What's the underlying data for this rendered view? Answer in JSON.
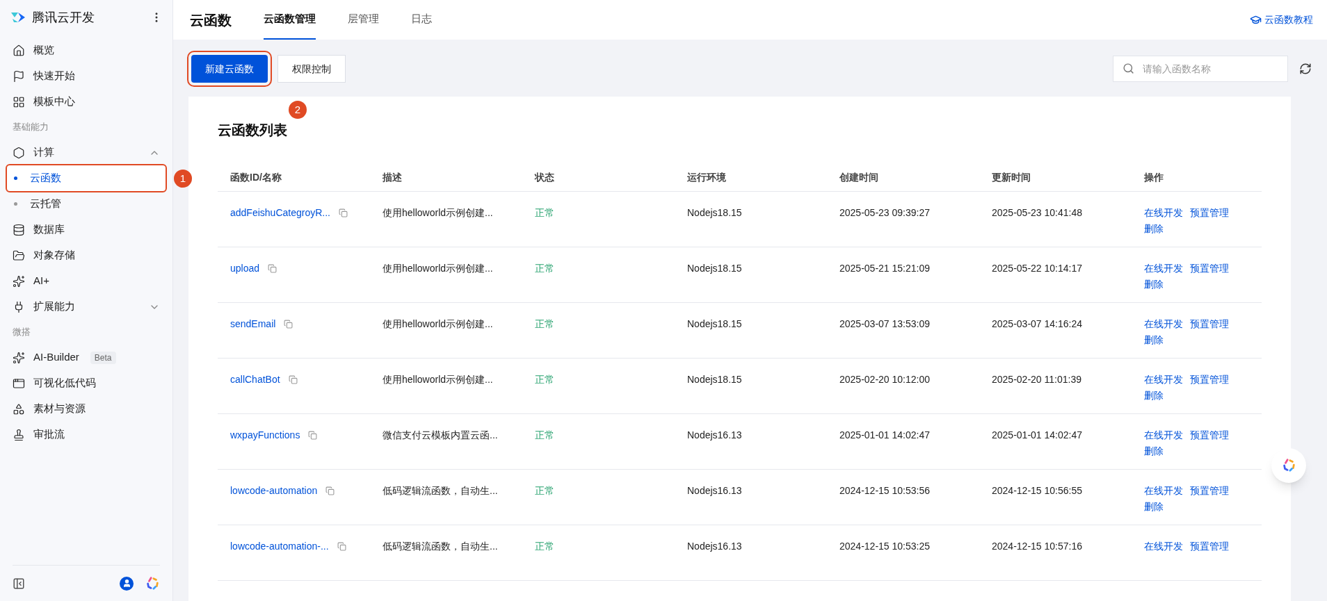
{
  "sidebar": {
    "brand": "腾讯云开发",
    "items": [
      {
        "kind": "item",
        "label": "概览",
        "selected": false
      },
      {
        "kind": "item",
        "label": "快速开始",
        "selected": false
      },
      {
        "kind": "item",
        "label": "模板中心",
        "selected": false
      },
      {
        "kind": "section",
        "label": "基础能力"
      },
      {
        "kind": "group",
        "label": "计算",
        "expanded": true,
        "children": [
          {
            "label": "云函数",
            "selected": true,
            "callout": "1"
          },
          {
            "label": "云托管",
            "selected": false
          }
        ]
      },
      {
        "kind": "item",
        "label": "数据库",
        "selected": false
      },
      {
        "kind": "item",
        "label": "对象存储",
        "selected": false
      },
      {
        "kind": "item",
        "label": "AI+",
        "selected": false
      },
      {
        "kind": "group",
        "label": "扩展能力",
        "expanded": false
      },
      {
        "kind": "section",
        "label": "微搭"
      },
      {
        "kind": "item",
        "label": "AI-Builder",
        "badge": "Beta",
        "selected": false
      },
      {
        "kind": "item",
        "label": "可视化低代码",
        "selected": false
      },
      {
        "kind": "item",
        "label": "素材与资源",
        "selected": false
      },
      {
        "kind": "item",
        "label": "审批流",
        "selected": false
      }
    ]
  },
  "header": {
    "title": "云函数",
    "tabs": [
      {
        "label": "云函数管理",
        "selected": true
      },
      {
        "label": "层管理",
        "selected": false
      },
      {
        "label": "日志",
        "selected": false
      }
    ],
    "help_link": "云函数教程"
  },
  "toolbar": {
    "buttons": [
      {
        "label": "新建云函数",
        "kind": "primary",
        "callout": "2"
      },
      {
        "label": "权限控制",
        "kind": "default"
      }
    ],
    "search": {
      "placeholder": "请输入函数名称"
    }
  },
  "table": {
    "title": "云函数列表",
    "columns": [
      "函数ID/名称",
      "描述",
      "状态",
      "运行环境",
      "创建时间",
      "更新时间",
      "操作"
    ],
    "rows": [
      {
        "name": "addFeishuCategroyR...",
        "description": "使用helloworld示例创建...",
        "status": "正常",
        "runtime": "Nodejs18.15",
        "created": "2025-05-23 09:39:27",
        "updated": "2025-05-23 10:41:48",
        "actions": [
          "在线开发",
          "预置管理",
          "删除"
        ]
      },
      {
        "name": "upload",
        "description": "使用helloworld示例创建...",
        "status": "正常",
        "runtime": "Nodejs18.15",
        "created": "2025-05-21 15:21:09",
        "updated": "2025-05-22 10:14:17",
        "actions": [
          "在线开发",
          "预置管理",
          "删除"
        ]
      },
      {
        "name": "sendEmail",
        "description": "使用helloworld示例创建...",
        "status": "正常",
        "runtime": "Nodejs18.15",
        "created": "2025-03-07 13:53:09",
        "updated": "2025-03-07 14:16:24",
        "actions": [
          "在线开发",
          "预置管理",
          "删除"
        ]
      },
      {
        "name": "callChatBot",
        "description": "使用helloworld示例创建...",
        "status": "正常",
        "runtime": "Nodejs18.15",
        "created": "2025-02-20 10:12:00",
        "updated": "2025-02-20 11:01:39",
        "actions": [
          "在线开发",
          "预置管理",
          "删除"
        ]
      },
      {
        "name": "wxpayFunctions",
        "description": "微信支付云模板内置云函...",
        "status": "正常",
        "runtime": "Nodejs16.13",
        "created": "2025-01-01 14:02:47",
        "updated": "2025-01-01 14:02:47",
        "actions": [
          "在线开发",
          "预置管理",
          "删除"
        ]
      },
      {
        "name": "lowcode-automation",
        "description": "低码逻辑流函数，自动生...",
        "status": "正常",
        "runtime": "Nodejs16.13",
        "created": "2024-12-15 10:53:56",
        "updated": "2024-12-15 10:56:55",
        "actions": [
          "在线开发",
          "预置管理",
          "删除"
        ]
      },
      {
        "name": "lowcode-automation-...",
        "description": "低码逻辑流函数，自动生...",
        "status": "正常",
        "runtime": "Nodejs16.13",
        "created": "2024-12-15 10:53:25",
        "updated": "2024-12-15 10:57:16",
        "actions": [
          "在线开发",
          "预置管理"
        ]
      }
    ]
  }
}
